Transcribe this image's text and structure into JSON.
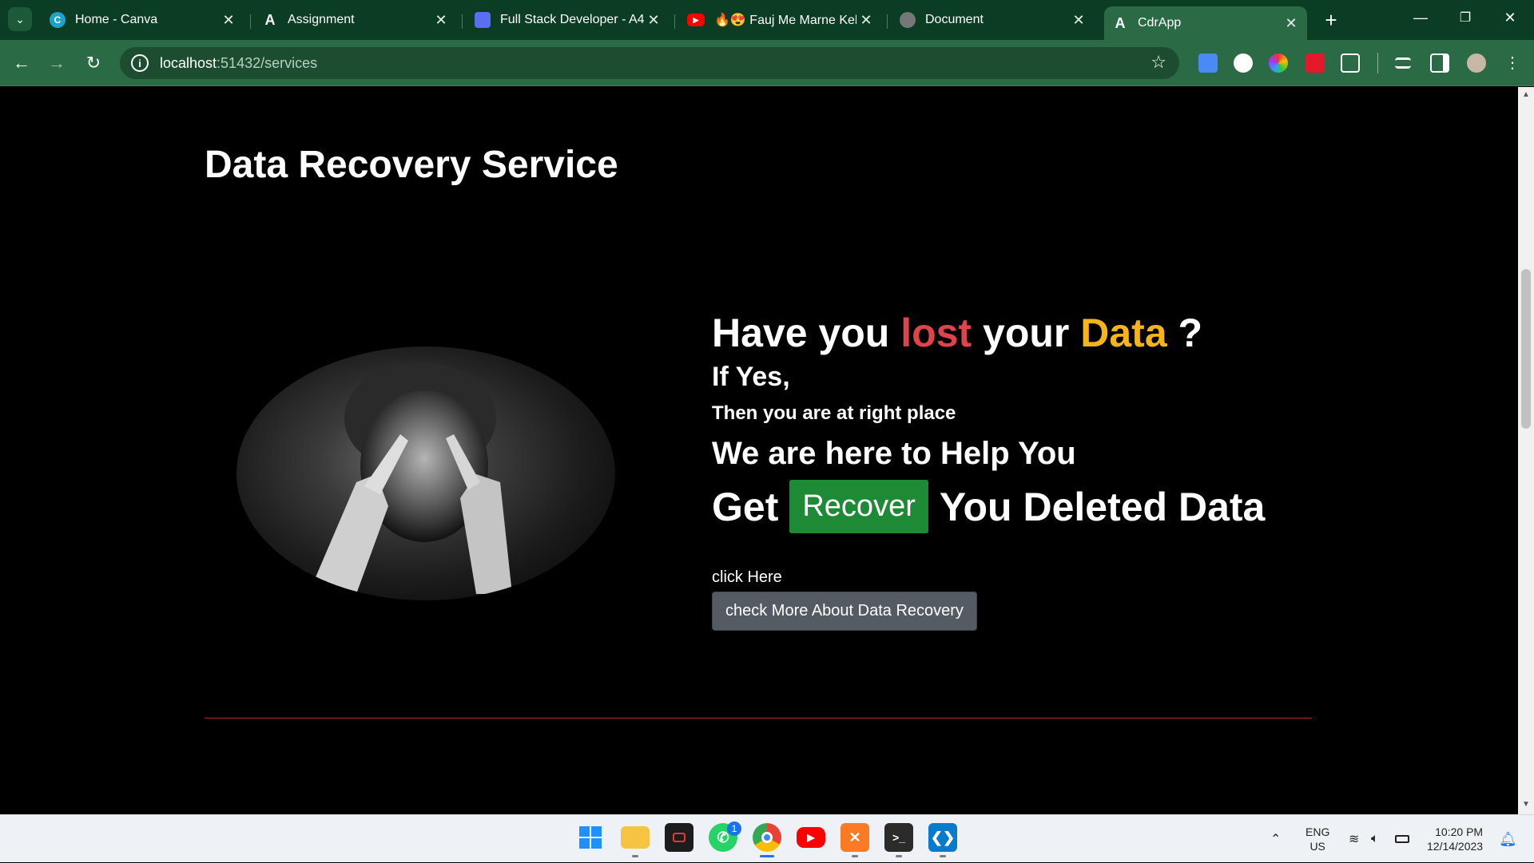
{
  "browser": {
    "tabs": [
      {
        "label": "Home - Canva",
        "icon": "canva-icon",
        "icon_color": "#1fa2c9",
        "glyph": "C",
        "active": false
      },
      {
        "label": "Assignment",
        "icon": "angular-icon",
        "icon_color": "#0a3d24",
        "glyph": "A",
        "active": false
      },
      {
        "label": "Full Stack Developer - A4",
        "icon": "document-app-icon",
        "icon_color": "#5b6df0",
        "glyph": "",
        "active": false
      },
      {
        "label": "🔥😍 Fauj Me Marne Keliye",
        "icon": "youtube-icon",
        "icon_color": "#ff0000",
        "glyph": "▶",
        "active": false
      },
      {
        "label": "Document",
        "icon": "globe-icon",
        "icon_color": "#777777",
        "glyph": "",
        "active": false
      },
      {
        "label": "CdrApp",
        "icon": "angular-icon",
        "icon_color": "#2a6a45",
        "glyph": "A",
        "active": true
      }
    ],
    "address": {
      "host": "localhost",
      "rest": ":51432/services"
    },
    "colors": {
      "tabstrip": "#0a3d24",
      "toolbar": "#2a6a45"
    }
  },
  "page": {
    "title": "Data Recovery Service",
    "hero": {
      "line1_a": "Have you ",
      "line1_lost": "lost",
      "line1_b": " your ",
      "line1_data": "Data",
      "line1_c": " ?",
      "if_yes": "If Yes,",
      "then": "Then you are at right place",
      "help": "We are here to Help You",
      "get": "Get",
      "recover_button": "Recover",
      "deleted": "You Deleted Data",
      "click_here": "click Here",
      "more_button": "check More About Data Recovery"
    },
    "colors": {
      "lost": "#e0434e",
      "data": "#f3b51b",
      "recover_btn": "#1e8a35",
      "more_btn": "#545b62",
      "divider": "#c0232b"
    }
  },
  "taskbar": {
    "apps": [
      {
        "name": "start-icon"
      },
      {
        "name": "file-explorer-icon"
      },
      {
        "name": "screen-recorder-icon"
      },
      {
        "name": "whatsapp-icon",
        "badge": "1"
      },
      {
        "name": "chrome-icon"
      },
      {
        "name": "youtube-icon"
      },
      {
        "name": "xampp-icon"
      },
      {
        "name": "terminal-icon"
      },
      {
        "name": "vscode-icon"
      }
    ],
    "tray": {
      "lang": "ENG",
      "region": "US",
      "time": "10:20 PM",
      "date": "12/14/2023"
    }
  }
}
